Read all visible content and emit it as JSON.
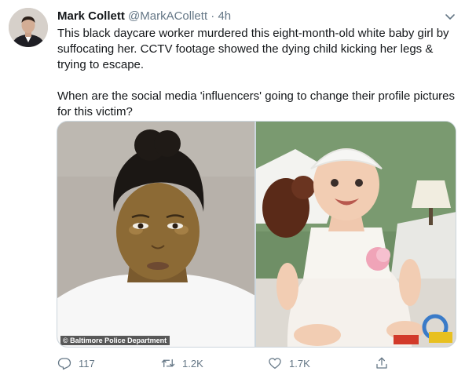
{
  "tweet": {
    "author_name": "Mark Collett",
    "author_handle": "@MarkACollett",
    "separator": "·",
    "time": "4h",
    "text_paragraph_1": "This black daycare worker murdered this eight-month-old white baby girl by suffocating her. CCTV footage showed the dying child kicking her legs & trying to escape.",
    "text_paragraph_2": "When are the social media 'influencers' going to change their profile pictures for this victim?"
  },
  "media": {
    "photo_1_credit": "© Baltimore Police Department"
  },
  "actions": {
    "reply_count": "117",
    "retweet_count": "1.2K",
    "like_count": "1.7K"
  },
  "icons": {
    "avatar": "avatar",
    "menu": "chevron-down-icon",
    "reply": "reply-icon",
    "retweet": "retweet-icon",
    "like": "heart-icon",
    "share": "share-icon"
  },
  "colors": {
    "text": "#14171a",
    "secondary_text": "#657786",
    "border": "#ccd6dd",
    "background": "#ffffff"
  }
}
